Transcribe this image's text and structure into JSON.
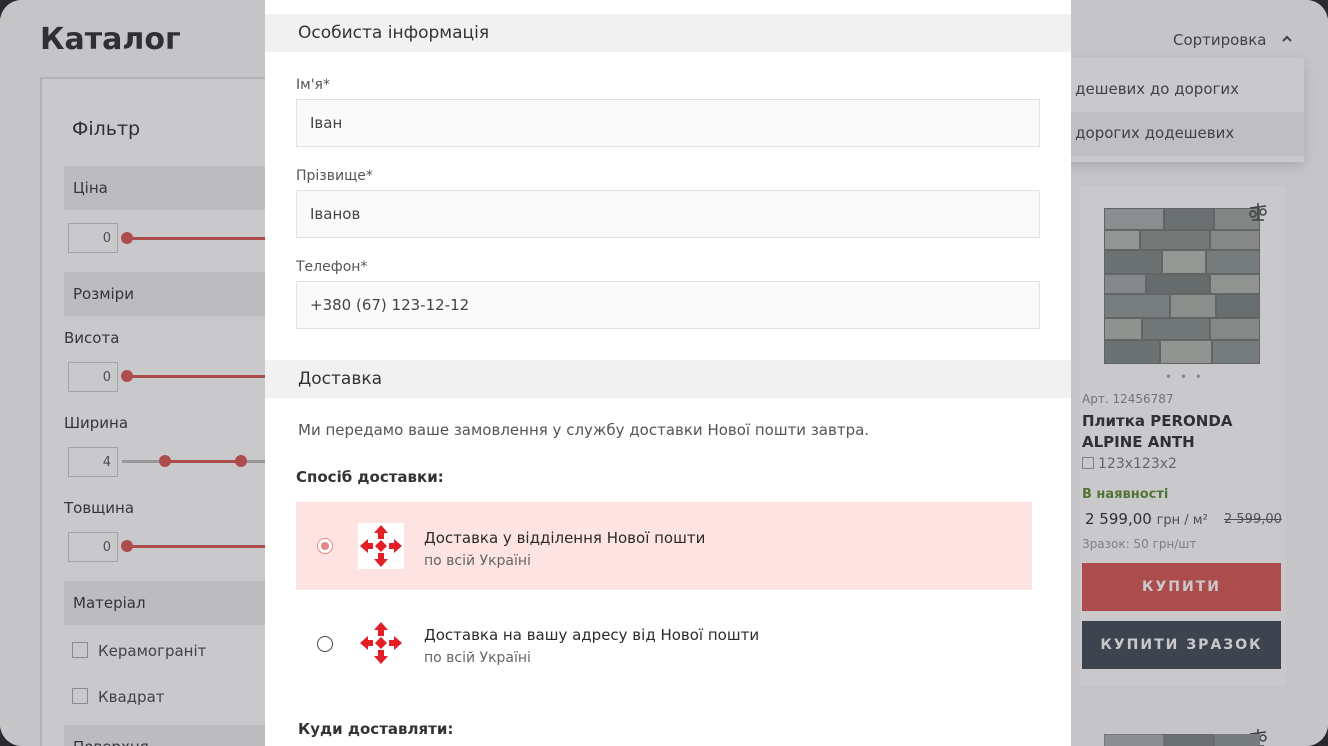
{
  "catalog": {
    "title": "Каталог",
    "sort": {
      "label": "Сортировка",
      "options": [
        "д дешевих до дорогих",
        "д дорогих додешевих"
      ]
    },
    "filter": {
      "title": "Фільтр",
      "price_label": "Ціна",
      "price_min": "0",
      "sizes_label": "Розміри",
      "height_label": "Висота",
      "height_min": "0",
      "width_label": "Ширина",
      "width_min": "4",
      "thickness_label": "Товщина",
      "thickness_min": "0",
      "material_label": "Матеріал",
      "materials": [
        "Керамограніт",
        "Квадрат"
      ],
      "next_section": "Поверхня"
    },
    "product": {
      "sku": "Арт. 12456787",
      "name": "Плитка PERONDA ALPINE ANTH",
      "size": "123x123x2",
      "stock": "В наявності",
      "price": "2 599,00",
      "price_unit": "грн / м²",
      "old_price": "2 599,00",
      "sample": "Зразок: 50 грн/шт",
      "buy_label": "КУПИТИ",
      "buy_sample_label": "КУПИТИ ЗРАЗОК",
      "dots": "• • •"
    }
  },
  "modal": {
    "personal_section": "Особиста інформація",
    "fields": {
      "first_name_label": "Ім'я*",
      "first_name_value": "Іван",
      "last_name_label": "Прізвище*",
      "last_name_value": "Іванов",
      "phone_label": "Телефон*",
      "phone_value": "+380 (67) 123-12-12"
    },
    "delivery_section": "Доставка",
    "delivery_note": "Ми передамо ваше замовлення у службу доставки Нової пошти завтра.",
    "method_label": "Спосіб доставки:",
    "options": [
      {
        "title": "Доставка у відділення Нової пошти",
        "subtitle": "по всій Україні",
        "selected": true
      },
      {
        "title": "Доставка на вашу адресу від Нової пошти",
        "subtitle": "по всій Україні",
        "selected": false
      }
    ],
    "where_label": "Куди доставляти:"
  },
  "colors": {
    "accent": "#d9534f",
    "selected_option_bg": "#fde3e2",
    "dark_button": "#3d4654",
    "nova_poshta_red": "#e31e24"
  },
  "icons": [
    "chevron-up-icon",
    "compare-scales-icon",
    "nova-poshta-logo",
    "size-icon"
  ]
}
